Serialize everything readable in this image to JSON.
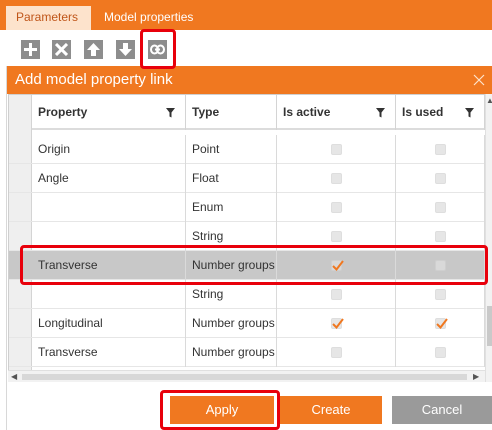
{
  "tabs": [
    {
      "label": "Parameters",
      "active": true
    },
    {
      "label": "Model properties",
      "active": false
    }
  ],
  "toolbar": {
    "buttons": [
      "add-icon",
      "delete-icon",
      "move-up-icon",
      "move-down-icon",
      "link-icon"
    ]
  },
  "dialog": {
    "title": "Add model property link",
    "columns": [
      "Property",
      "Type",
      "Is active",
      "Is used"
    ],
    "rows": [
      {
        "property": "Origin",
        "type": "Point",
        "is_active": false,
        "is_used": false
      },
      {
        "property": "Angle",
        "type": "Float",
        "is_active": false,
        "is_used": false
      },
      {
        "property": "",
        "type": "Enum",
        "is_active": false,
        "is_used": false
      },
      {
        "property": "",
        "type": "String",
        "is_active": false,
        "is_used": false
      },
      {
        "property": "Transverse",
        "type": "Number groups",
        "is_active": true,
        "is_used": false,
        "selected": true
      },
      {
        "property": "",
        "type": "String",
        "is_active": false,
        "is_used": false
      },
      {
        "property": "Longitudinal",
        "type": "Number groups",
        "is_active": true,
        "is_used": true
      },
      {
        "property": "Transverse",
        "type": "Number groups",
        "is_active": false,
        "is_used": false
      }
    ],
    "buttons": {
      "apply": "Apply",
      "create": "Create",
      "cancel": "Cancel"
    }
  },
  "colors": {
    "accent": "#f07820",
    "highlight": "#e8000b",
    "selected_row": "#c8c8c8"
  }
}
